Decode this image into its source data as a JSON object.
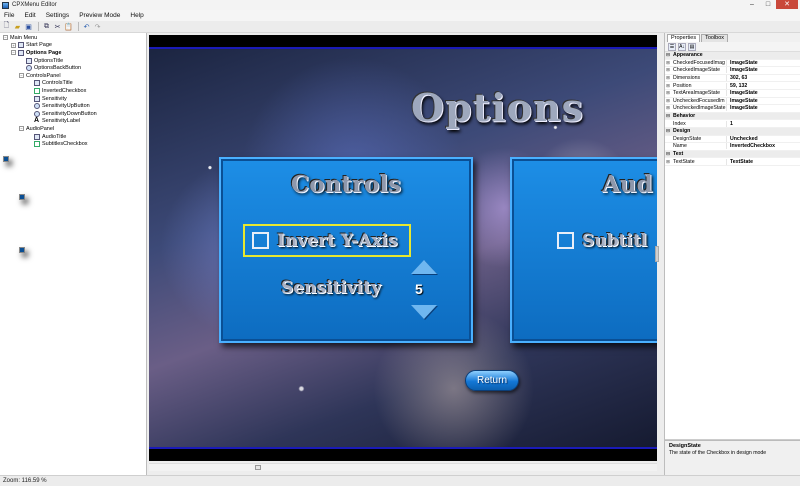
{
  "window": {
    "title": "CPXMenu Editor",
    "minimize": "–",
    "maximize": "□",
    "close": "✕"
  },
  "menu": [
    "File",
    "Edit",
    "Settings",
    "Preview Mode",
    "Help"
  ],
  "toolbar": {
    "icons": [
      "new-icon",
      "open-icon",
      "save-icon",
      "copy-icon",
      "cut-icon",
      "paste-icon",
      "undo-icon",
      "redo-icon"
    ]
  },
  "tree": [
    {
      "label": "Main Menu",
      "indent": 0,
      "expander": "−",
      "kind": "panel",
      "bold": false
    },
    {
      "label": "Start Page",
      "indent": 1,
      "expander": "+",
      "kind": "page",
      "bold": false
    },
    {
      "label": "Options Page",
      "indent": 1,
      "expander": "−",
      "kind": "page",
      "bold": true
    },
    {
      "label": "OptionsTitle",
      "indent": 2,
      "expander": "",
      "kind": "page",
      "bold": false
    },
    {
      "label": "OptionsBackButton",
      "indent": 2,
      "expander": "",
      "kind": "btn",
      "bold": false
    },
    {
      "label": "ControlsPanel",
      "indent": 2,
      "expander": "−",
      "kind": "panel",
      "bold": false
    },
    {
      "label": "ControlsTitle",
      "indent": 3,
      "expander": "",
      "kind": "page",
      "bold": false
    },
    {
      "label": "InvertedCheckbox",
      "indent": 3,
      "expander": "",
      "kind": "chk",
      "bold": false
    },
    {
      "label": "Sensitivity",
      "indent": 3,
      "expander": "",
      "kind": "page",
      "bold": false
    },
    {
      "label": "SensitivityUpButton",
      "indent": 3,
      "expander": "",
      "kind": "btn",
      "bold": false
    },
    {
      "label": "SensitivityDownButton",
      "indent": 3,
      "expander": "",
      "kind": "btn",
      "bold": false
    },
    {
      "label": "SensitivityLabel",
      "indent": 3,
      "expander": "",
      "kind": "lbl",
      "bold": false
    },
    {
      "label": "AudioPanel",
      "indent": 2,
      "expander": "−",
      "kind": "panel",
      "bold": false
    },
    {
      "label": "AudioTitle",
      "indent": 3,
      "expander": "",
      "kind": "page",
      "bold": false
    },
    {
      "label": "SubtitlesCheckbox",
      "indent": 3,
      "expander": "",
      "kind": "chk",
      "bold": false
    }
  ],
  "canvas": {
    "options_title": "Options",
    "controls_panel": {
      "title": "Controls",
      "checkbox_label": "Invert Y-Axis",
      "sensitivity_label": "Sensitivity",
      "sensitivity_value": "5"
    },
    "audio_panel": {
      "title": "Aud",
      "checkbox_label": "Subtitl"
    },
    "return_label": "Return"
  },
  "properties": {
    "tabs": [
      "Properties",
      "Toolbox"
    ],
    "active_tab": "Properties",
    "rows": [
      {
        "type": "cat",
        "name": "Appearance",
        "value": ""
      },
      {
        "type": "prop",
        "exp": "⊞",
        "name": "CheckedFocusedImag",
        "value": "ImageState"
      },
      {
        "type": "prop",
        "exp": "⊞",
        "name": "CheckedImageState",
        "value": "ImageState"
      },
      {
        "type": "prop",
        "exp": "⊞",
        "name": "Dimensions",
        "value": "302, 63"
      },
      {
        "type": "prop",
        "exp": "⊞",
        "name": "Position",
        "value": "59, 132"
      },
      {
        "type": "prop",
        "exp": "⊞",
        "name": "TextAreaImageState",
        "value": "ImageState"
      },
      {
        "type": "prop",
        "exp": "⊞",
        "name": "UncheckedFocusedIm",
        "value": "ImageState"
      },
      {
        "type": "prop",
        "exp": "⊞",
        "name": "UncheckedImageState",
        "value": "ImageState"
      },
      {
        "type": "cat",
        "name": "Behavior",
        "value": ""
      },
      {
        "type": "prop",
        "exp": "",
        "name": "Index",
        "value": "1"
      },
      {
        "type": "cat",
        "name": "Design",
        "value": ""
      },
      {
        "type": "prop",
        "exp": "",
        "name": "DesignState",
        "value": "Unchecked"
      },
      {
        "type": "prop",
        "exp": "",
        "name": "Name",
        "value": "InvertedCheckbox"
      },
      {
        "type": "cat",
        "name": "Text",
        "value": ""
      },
      {
        "type": "prop",
        "exp": "⊞",
        "name": "TextState",
        "value": "TextState"
      }
    ],
    "description": {
      "title": "DesignState",
      "text": "The state of the Checkbox in design mode"
    }
  },
  "status": {
    "zoom": "Zoom: 116.59 %"
  }
}
